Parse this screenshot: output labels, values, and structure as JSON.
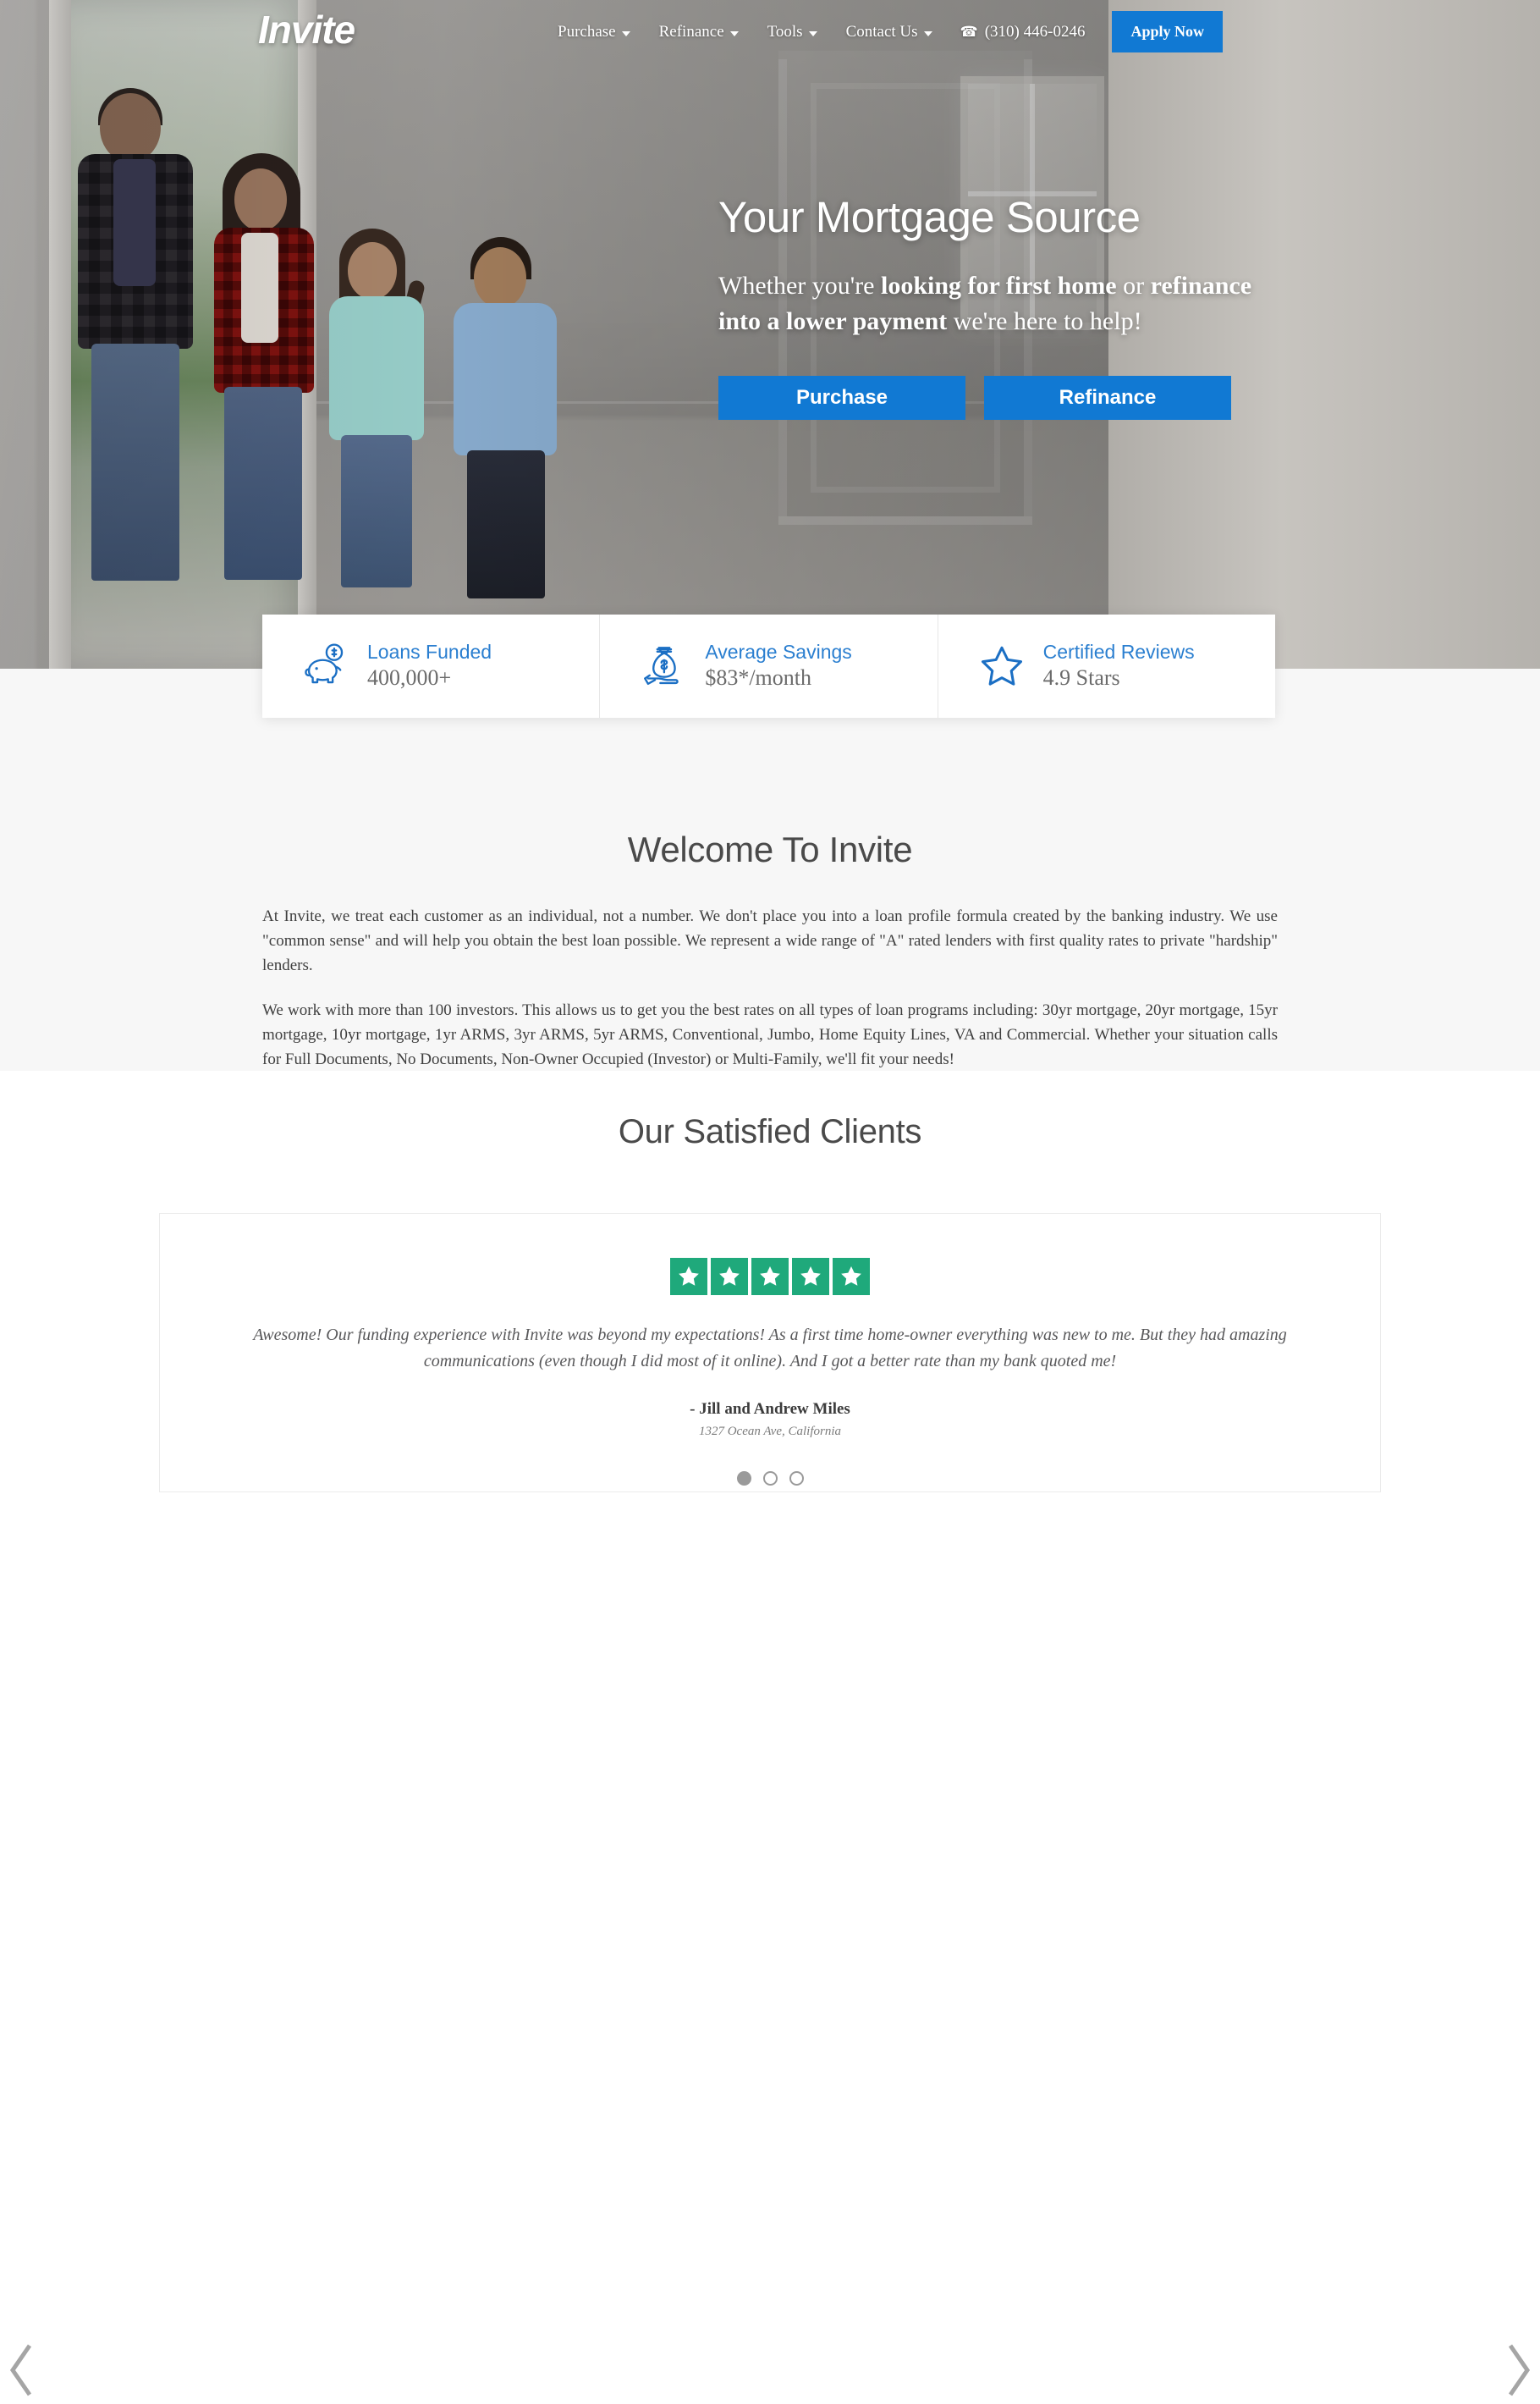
{
  "brand": {
    "logo_text": "Invite",
    "accent_blue": "#1179d3",
    "link_blue": "#2b7fd0",
    "star_green": "#1fa97b"
  },
  "nav": {
    "items": [
      {
        "label": "Purchase",
        "has_caret": true
      },
      {
        "label": "Refinance",
        "has_caret": true
      },
      {
        "label": "Tools",
        "has_caret": true
      },
      {
        "label": "Contact Us",
        "has_caret": true
      }
    ],
    "phone": "(310) 446-0246",
    "phone_icon": "phone-icon",
    "apply_label": "Apply Now"
  },
  "hero": {
    "title": "Your Mortgage Source",
    "sub_1": "Whether you're ",
    "sub_bold_1": "looking for first home",
    "sub_2": " or ",
    "sub_bold_2": "refinance into a lower payment",
    "sub_3": " we're here to help!",
    "btn_purchase": "Purchase",
    "btn_refinance": "Refinance"
  },
  "stats": [
    {
      "icon": "piggy-bank-icon",
      "label": "Loans Funded",
      "value": "400,000+"
    },
    {
      "icon": "money-bag-hand-icon",
      "label": "Average Savings",
      "value": "$83*/month"
    },
    {
      "icon": "star-outline-icon",
      "label": "Certified Reviews",
      "value": "4.9 Stars"
    }
  ],
  "welcome": {
    "heading": "Welcome To Invite",
    "paragraph_1": "At Invite, we treat each customer as an individual, not a number. We don't place you into a loan profile formula created by the banking industry. We use \"common sense\" and will help you obtain the best loan possible. We represent a wide range of \"A\" rated lenders with first quality rates to private \"hardship\" lenders.",
    "paragraph_2": "We work with more than 100 investors. This allows us to get you the best rates on all types of loan programs including: 30yr mortgage, 20yr mortgage, 15yr mortgage, 10yr mortgage, 1yr ARMS, 3yr ARMS, 5yr ARMS, Conventional, Jumbo, Home Equity Lines, VA and Commercial. Whether your situation calls for Full Documents, No Documents, Non-Owner Occupied (Investor) or Multi-Family, we'll fit your needs!"
  },
  "clients": {
    "heading": "Our Satisfied Clients",
    "rating_stars": 5,
    "quote": "Awesome! Our funding experience with Invite was beyond my expectations! As a first time home-owner everything was new to me. But they had amazing communications (even though I did most of it online). And I got a better rate than my bank quoted me!",
    "author": "- Jill and Andrew Miles",
    "location": "1327 Ocean Ave, California",
    "dots": 3,
    "prev_icon": "chevron-left-icon",
    "next_icon": "chevron-right-icon"
  }
}
